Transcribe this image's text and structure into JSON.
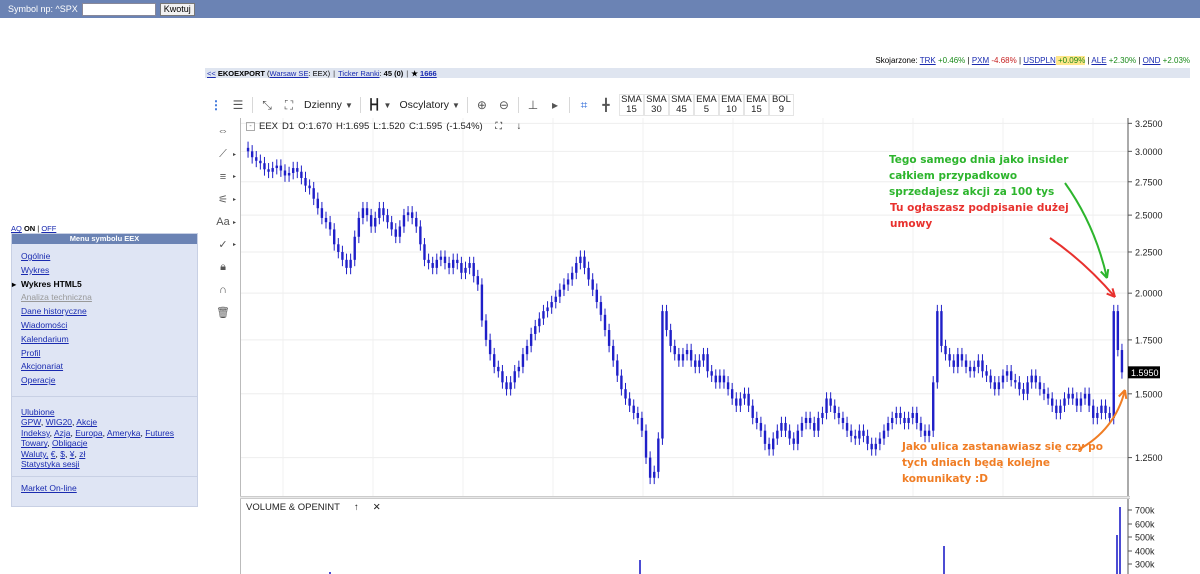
{
  "topbar": {
    "label": "Symbol np: ^SPX",
    "input_value": "",
    "button": "Kwotuj"
  },
  "ticker": {
    "prefix": "Skojarzone:",
    "items": [
      {
        "sym": "TRK",
        "chg": "+0.46%",
        "dir": "up"
      },
      {
        "sym": "PXM",
        "chg": "-4.68%",
        "dir": "down"
      },
      {
        "sym": "USDPLN",
        "chg": "+0.09%",
        "dir": "hl"
      },
      {
        "sym": "ALE",
        "chg": "+2.30%",
        "dir": "up"
      },
      {
        "sym": "OND",
        "chg": "+2.03%",
        "dir": "up"
      }
    ]
  },
  "tabline": {
    "back": "<<",
    "company": "EKOEXPORT",
    "exchange": "Warsaw SE",
    "ticker": "EEX",
    "ranking_label": "Ticker Ranki",
    "ranking": "45 (0)",
    "star": "★",
    "star_count": "1666"
  },
  "aq": {
    "label": "AQ",
    "on": "ON",
    "off": "OFF"
  },
  "sidebar": {
    "title": "Menu symbolu EEX",
    "items": [
      {
        "label": "Ogólnie",
        "state": "link"
      },
      {
        "label": "Wykres",
        "state": "link"
      },
      {
        "label": "Wykres HTML5",
        "state": "active"
      },
      {
        "label": "Analiza techniczna",
        "state": "disabled"
      },
      {
        "label": "Dane historyczne",
        "state": "link"
      },
      {
        "label": "Wiadomości",
        "state": "link"
      },
      {
        "label": "Kalendarium",
        "state": "link"
      },
      {
        "label": "Profil",
        "state": "link"
      },
      {
        "label": "Akcjonariat",
        "state": "link"
      },
      {
        "label": "Operacje",
        "state": "link"
      }
    ],
    "fav": "Ulubione",
    "line1": [
      "GPW",
      "WIG20",
      "Akcje"
    ],
    "line2": [
      "Indeksy",
      "Azja",
      "Europa",
      "Ameryka",
      "Futures"
    ],
    "line3": [
      "Towary",
      "Obligacje"
    ],
    "line4_label": "Waluty,",
    "line4": [
      "€",
      "$",
      "¥",
      "zł"
    ],
    "stats": "Statystyka sesji",
    "market": "Market On-line"
  },
  "toolbar": {
    "interval": "Dzienny",
    "oscillators": "Oscylatory",
    "indicators": [
      {
        "name": "SMA",
        "period": "15"
      },
      {
        "name": "SMA",
        "period": "30"
      },
      {
        "name": "SMA",
        "period": "45"
      },
      {
        "name": "EMA",
        "period": "5"
      },
      {
        "name": "EMA",
        "period": "10"
      },
      {
        "name": "EMA",
        "period": "15"
      },
      {
        "name": "BOL",
        "period": "9"
      }
    ]
  },
  "legend": {
    "collapse": "-",
    "symbol": "EEX",
    "interval": "D1",
    "open": "O:1.670",
    "high": "H:1.695",
    "low": "L:1.520",
    "close": "C:1.595",
    "change": "(-1.54%)"
  },
  "volume_legend": {
    "title": "VOLUME & OPENINT",
    "up": "↑",
    "close": "✕"
  },
  "annotations": {
    "green": [
      "Tego samego dnia jako insider",
      "całkiem przypadkowo",
      "sprzedajesz akcji za 100 tys"
    ],
    "red": [
      "Tu ogłaszasz podpisanie dużej",
      "umowy"
    ],
    "orange": [
      "Jako ulica zastanawiasz się czy po",
      "tych dniach będą kolejne",
      "komunikaty :D"
    ]
  },
  "colors": {
    "candle": "#1f1fc8",
    "annotation_green": "#2db52d",
    "annotation_red": "#e8312e",
    "annotation_orange": "#f07d24"
  },
  "chart_data": {
    "type": "candlestick",
    "y_scale": "log",
    "ylim": [
      1.12,
      3.3
    ],
    "yticks": [
      "3.2500",
      "3.0000",
      "2.7500",
      "2.5000",
      "2.2500",
      "2.0000",
      "1.7500",
      "1.5000",
      "1.2500"
    ],
    "last_price": "1.5950",
    "closes": [
      3.0,
      2.95,
      2.92,
      2.9,
      2.85,
      2.83,
      2.86,
      2.88,
      2.84,
      2.8,
      2.82,
      2.86,
      2.83,
      2.78,
      2.72,
      2.7,
      2.62,
      2.55,
      2.48,
      2.45,
      2.4,
      2.3,
      2.25,
      2.2,
      2.15,
      2.2,
      2.35,
      2.48,
      2.55,
      2.5,
      2.42,
      2.48,
      2.55,
      2.5,
      2.45,
      2.4,
      2.35,
      2.42,
      2.5,
      2.52,
      2.48,
      2.42,
      2.3,
      2.2,
      2.18,
      2.15,
      2.2,
      2.22,
      2.18,
      2.15,
      2.2,
      2.18,
      2.12,
      2.15,
      2.18,
      2.1,
      2.05,
      1.85,
      1.75,
      1.68,
      1.62,
      1.6,
      1.55,
      1.52,
      1.55,
      1.6,
      1.62,
      1.68,
      1.72,
      1.78,
      1.82,
      1.86,
      1.9,
      1.92,
      1.95,
      1.98,
      2.02,
      2.05,
      2.08,
      2.12,
      2.18,
      2.22,
      2.15,
      2.08,
      2.02,
      1.95,
      1.88,
      1.8,
      1.72,
      1.65,
      1.58,
      1.52,
      1.48,
      1.45,
      1.42,
      1.4,
      1.35,
      1.25,
      1.18,
      1.2,
      1.32,
      1.9,
      1.8,
      1.72,
      1.68,
      1.65,
      1.68,
      1.7,
      1.65,
      1.62,
      1.65,
      1.68,
      1.6,
      1.58,
      1.55,
      1.58,
      1.55,
      1.52,
      1.48,
      1.45,
      1.48,
      1.5,
      1.45,
      1.4,
      1.38,
      1.35,
      1.3,
      1.28,
      1.32,
      1.35,
      1.38,
      1.35,
      1.32,
      1.3,
      1.35,
      1.38,
      1.4,
      1.38,
      1.35,
      1.4,
      1.42,
      1.48,
      1.45,
      1.42,
      1.4,
      1.38,
      1.35,
      1.33,
      1.32,
      1.35,
      1.33,
      1.3,
      1.28,
      1.3,
      1.32,
      1.35,
      1.38,
      1.4,
      1.42,
      1.4,
      1.38,
      1.4,
      1.42,
      1.38,
      1.35,
      1.33,
      1.35,
      1.55,
      1.9,
      1.72,
      1.68,
      1.65,
      1.62,
      1.68,
      1.65,
      1.62,
      1.6,
      1.62,
      1.65,
      1.6,
      1.58,
      1.55,
      1.52,
      1.55,
      1.58,
      1.6,
      1.56,
      1.55,
      1.52,
      1.5,
      1.55,
      1.58,
      1.55,
      1.52,
      1.5,
      1.48,
      1.45,
      1.42,
      1.45,
      1.48,
      1.5,
      1.48,
      1.45,
      1.48,
      1.5,
      1.45,
      1.4,
      1.42,
      1.45,
      1.42,
      1.4,
      1.9,
      1.7,
      1.595
    ],
    "vol_ticks": [
      "700k",
      "600k",
      "500k",
      "400k",
      "300k"
    ]
  }
}
